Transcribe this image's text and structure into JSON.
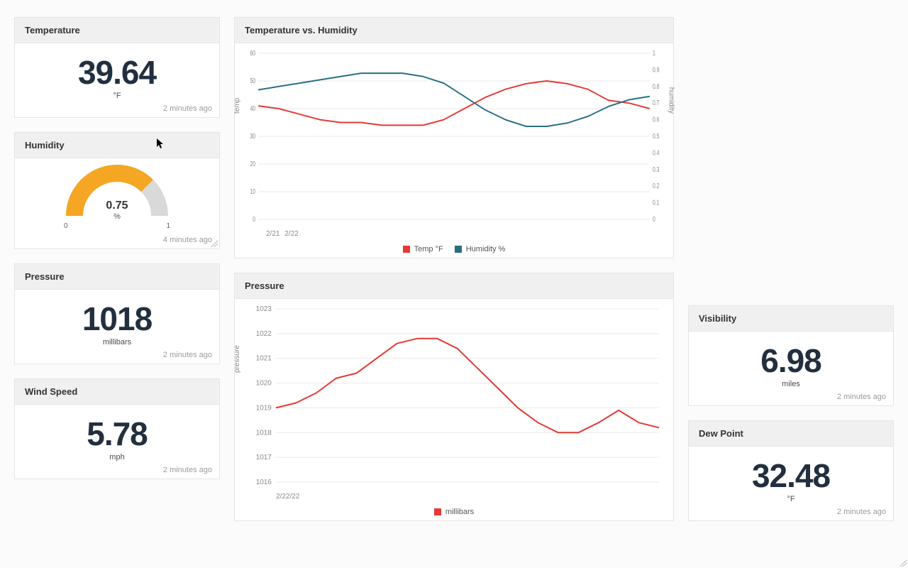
{
  "cards": {
    "temperature": {
      "title": "Temperature",
      "value": "39.64",
      "unit": "°F",
      "footer": "2 minutes ago"
    },
    "humidity": {
      "title": "Humidity",
      "value": "0.75",
      "unit": "%",
      "min": "0",
      "max": "1",
      "footer": "4 minutes ago"
    },
    "pressure_metric": {
      "title": "Pressure",
      "value": "1018",
      "unit": "millibars",
      "footer": "2 minutes ago"
    },
    "windspeed": {
      "title": "Wind Speed",
      "value": "5.78",
      "unit": "mph",
      "footer": "2 minutes ago"
    },
    "visibility": {
      "title": "Visibility",
      "value": "6.98",
      "unit": "miles",
      "footer": "2 minutes ago"
    },
    "dewpoint": {
      "title": "Dew Point",
      "value": "32.48",
      "unit": "°F",
      "footer": "2 minutes ago"
    }
  },
  "temp_humidity_chart": {
    "title": "Temperature vs. Humidity",
    "legend": {
      "temp": "Temp °F",
      "humidity": "Humidity %"
    },
    "ylabel_left": "temp",
    "ylabel_right": "humidity",
    "xticklabels": [
      "2/21",
      "2/22"
    ]
  },
  "pressure_chart": {
    "title": "Pressure",
    "legend": {
      "series": "millibars"
    },
    "ylabel": "pressure",
    "xticklabel": "2/22/22"
  },
  "colors": {
    "red": "#e53935",
    "teal": "#276e83",
    "orange": "#f5a623"
  },
  "chart_data": [
    {
      "type": "line",
      "title": "Temperature vs. Humidity",
      "xlabel": "",
      "x": [
        0,
        1,
        2,
        3,
        4,
        5,
        6,
        7,
        8,
        9,
        10,
        11,
        12,
        13,
        14,
        15,
        16,
        17,
        18,
        19
      ],
      "x_tick_labels": [
        "2/21",
        "2/22"
      ],
      "series": [
        {
          "name": "Temp °F",
          "axis": "left",
          "color": "#e53935",
          "values": [
            41,
            40,
            38,
            36,
            35,
            35,
            34,
            34,
            34,
            36,
            40,
            44,
            47,
            49,
            50,
            49,
            47,
            43,
            42,
            40
          ]
        },
        {
          "name": "Humidity %",
          "axis": "right",
          "color": "#276e83",
          "values": [
            0.78,
            0.8,
            0.82,
            0.84,
            0.86,
            0.88,
            0.88,
            0.88,
            0.86,
            0.82,
            0.74,
            0.66,
            0.6,
            0.56,
            0.56,
            0.58,
            0.62,
            0.68,
            0.72,
            0.74
          ]
        }
      ],
      "yticks_left": [
        0,
        10,
        20,
        30,
        40,
        50,
        60
      ],
      "ylim_left": [
        0,
        60
      ],
      "yticks_right": [
        0,
        0.1,
        0.2,
        0.3,
        0.4,
        0.5,
        0.6,
        0.7,
        0.8,
        0.9,
        1
      ],
      "ylim_right": [
        0,
        1
      ],
      "ylabel_left": "temp",
      "ylabel_right": "humidity",
      "legend_position": "bottom"
    },
    {
      "type": "line",
      "title": "Pressure",
      "xlabel": "",
      "ylabel": "pressure",
      "x": [
        0,
        1,
        2,
        3,
        4,
        5,
        6,
        7,
        8,
        9,
        10,
        11,
        12,
        13,
        14,
        15,
        16,
        17,
        18,
        19
      ],
      "x_tick_labels": [
        "2/22/22"
      ],
      "series": [
        {
          "name": "millibars",
          "color": "#e53935",
          "values": [
            1019.0,
            1019.2,
            1019.6,
            1020.2,
            1020.4,
            1021.0,
            1021.6,
            1021.8,
            1021.8,
            1021.4,
            1020.6,
            1019.8,
            1019.0,
            1018.4,
            1018.0,
            1018.0,
            1018.4,
            1018.9,
            1018.4,
            1018.2
          ]
        }
      ],
      "yticks": [
        1016,
        1017,
        1018,
        1019,
        1020,
        1021,
        1022,
        1023
      ],
      "ylim": [
        1016,
        1023
      ],
      "legend_position": "bottom"
    },
    {
      "type": "gauge",
      "title": "Humidity",
      "value": 0.75,
      "min": 0,
      "max": 1,
      "unit": "%",
      "color": "#f5a623"
    }
  ]
}
